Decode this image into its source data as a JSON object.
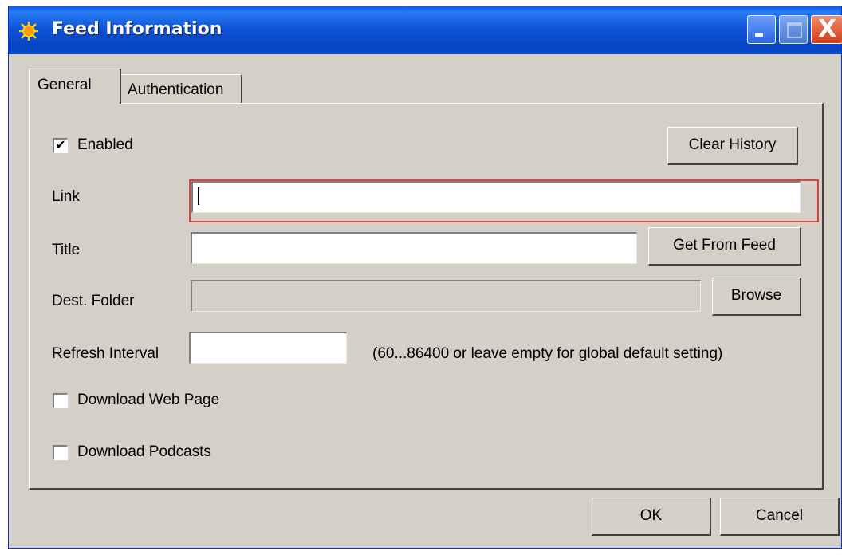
{
  "window": {
    "title": "Feed Information",
    "close_glyph": "X"
  },
  "tabs": [
    {
      "label": "General",
      "selected": true
    },
    {
      "label": "Authentication",
      "selected": false
    }
  ],
  "general": {
    "enabled": {
      "label": "Enabled",
      "checked": true,
      "check_glyph": "✔"
    },
    "clear_history_label": "Clear History",
    "link": {
      "label": "Link",
      "value": ""
    },
    "title": {
      "label": "Title",
      "value": ""
    },
    "get_from_feed_label": "Get From Feed",
    "dest_folder": {
      "label": "Dest. Folder",
      "value": ""
    },
    "browse_label": "Browse",
    "refresh_interval": {
      "label": "Refresh Interval",
      "value": "",
      "hint": "(60...86400 or leave empty for global default setting)"
    },
    "download_web_page": {
      "label": "Download Web Page",
      "checked": false
    },
    "download_podcasts": {
      "label": "Download Podcasts",
      "checked": false
    }
  },
  "footer": {
    "ok_label": "OK",
    "cancel_label": "Cancel"
  },
  "colors": {
    "titlebar": "#0a47c0",
    "face": "#d4d0c8",
    "focus_ring": "#e04040"
  }
}
